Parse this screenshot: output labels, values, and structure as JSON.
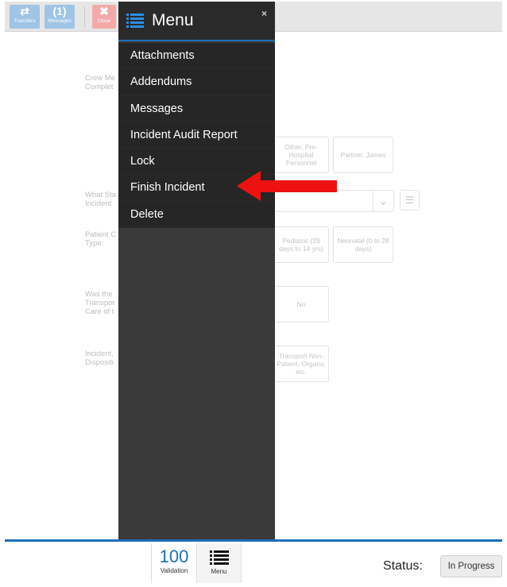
{
  "toolbar": {
    "transfers": {
      "glyph": "⇄",
      "label": "Transfers"
    },
    "messages": {
      "count": "(1)",
      "label": "Messages"
    },
    "close": {
      "glyph": "✖",
      "label": "Close"
    }
  },
  "form": {
    "labels": {
      "crew": "Crew Me Complet",
      "stage": "What Sta Incident",
      "patient_type": "Patient C Type:",
      "transport": "Was the Transpor Care of t",
      "disposition": "Incident, Dispositi"
    },
    "options": {
      "other_prehospital": "Other, Pre-Hospital Personnel",
      "partner": "Partner, James",
      "pediatric": "Pediatric (29 days to 14 yrs)",
      "neonatal": "Neonatal (0 to 28 days)",
      "no": "No",
      "transport_non_patient": "Transport Non-Patient, Organs, etc."
    }
  },
  "menu": {
    "title": "Menu",
    "close_glyph": "×",
    "items": [
      {
        "label": "Attachments"
      },
      {
        "label": "Addendums"
      },
      {
        "label": "Messages"
      },
      {
        "label": "Incident Audit Report"
      },
      {
        "label": "Lock"
      },
      {
        "label": "Finish Incident"
      },
      {
        "label": "Delete"
      }
    ]
  },
  "bottom": {
    "validation_count": "100",
    "validation_label": "Validation",
    "menu_label": "Menu",
    "status_label": "Status:",
    "status_value": "In Progress"
  },
  "colors": {
    "accent": "#1e6fb8",
    "arrow": "#ee1111",
    "menu_bg": "#3a3a3a",
    "menu_item_bg": "#262626"
  },
  "icons": {
    "transfers": "transfer-arrows-icon",
    "messages": "messages-icon",
    "close": "close-icon",
    "menu": "list-icon",
    "dropdown": "chevron-down-icon",
    "annotation": "red-arrow-icon"
  }
}
